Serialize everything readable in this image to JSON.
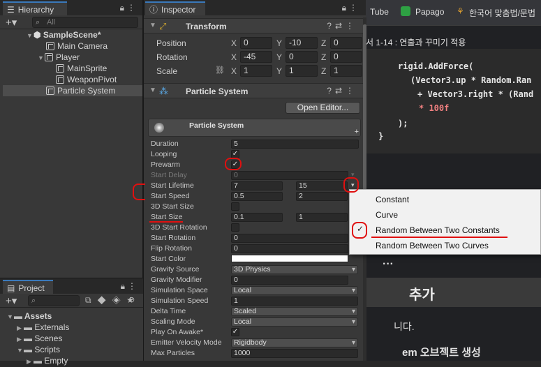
{
  "hierarchy": {
    "tab_label": "Hierarchy",
    "search_placeholder": "All",
    "scene": "SampleScene*",
    "items": [
      "Main Camera",
      "Player",
      "MainSprite",
      "WeaponPivot",
      "Particle System"
    ]
  },
  "project": {
    "tab_label": "Project",
    "folders": [
      "Assets",
      "Externals",
      "Scenes",
      "Scripts",
      "Empty"
    ]
  },
  "inspector": {
    "tab_label": "Inspector",
    "transform": {
      "title": "Transform",
      "position_label": "Position",
      "rotation_label": "Rotation",
      "scale_label": "Scale",
      "position": {
        "x": "0",
        "y": "-10",
        "z": "0"
      },
      "rotation": {
        "x": "-45",
        "y": "0",
        "z": "0"
      },
      "scale": {
        "x": "1",
        "y": "1",
        "z": "1"
      }
    },
    "particle": {
      "title": "Particle System",
      "open_editor": "Open Editor...",
      "module_title": "Particle System",
      "props": {
        "duration": {
          "label": "Duration",
          "value": "5"
        },
        "looping": {
          "label": "Looping"
        },
        "prewarm": {
          "label": "Prewarm"
        },
        "start_delay": {
          "label": "Start Delay",
          "value": "0"
        },
        "start_lifetime": {
          "label": "Start Lifetime",
          "min": "7",
          "max": "15"
        },
        "start_speed": {
          "label": "Start Speed",
          "min": "0.5",
          "max": "2"
        },
        "size3d": {
          "label": "3D Start Size"
        },
        "start_size": {
          "label": "Start Size",
          "min": "0.1",
          "max": "1"
        },
        "rot3d": {
          "label": "3D Start Rotation"
        },
        "start_rotation": {
          "label": "Start Rotation",
          "value": "0"
        },
        "flip_rotation": {
          "label": "Flip Rotation",
          "value": "0"
        },
        "start_color": {
          "label": "Start Color"
        },
        "gravity_source": {
          "label": "Gravity Source",
          "value": "3D Physics"
        },
        "gravity_modifier": {
          "label": "Gravity Modifier",
          "value": "0"
        },
        "sim_space": {
          "label": "Simulation Space",
          "value": "Local"
        },
        "sim_speed": {
          "label": "Simulation Speed",
          "value": "1"
        },
        "delta_time": {
          "label": "Delta Time",
          "value": "Scaled"
        },
        "scaling_mode": {
          "label": "Scaling Mode",
          "value": "Local"
        },
        "play_on_awake": {
          "label": "Play On Awake*"
        },
        "emitter_velocity": {
          "label": "Emitter Velocity Mode",
          "value": "Rigidbody"
        },
        "max_particles": {
          "label": "Max Particles",
          "value": "1000"
        }
      }
    }
  },
  "popup": {
    "options": [
      "Constant",
      "Curve",
      "Random Between Two Constants",
      "Random Between Two Curves"
    ],
    "checked_index": 2
  },
  "browser": {
    "bookmarks": [
      "Tube",
      "Papago",
      "한국어 맞춤법/문법"
    ],
    "heading": "서 1-14 : 연출과 꾸미기 적용",
    "code": [
      "rigid.AddForce(",
      "(Vector3.up * Random.Ran",
      " + Vector3.right * (Rand",
      "* 100f",
      ");",
      "}"
    ],
    "more": "···",
    "section_title": "추가",
    "text1": "니다.",
    "text2": "em 오브젝트 생성"
  }
}
